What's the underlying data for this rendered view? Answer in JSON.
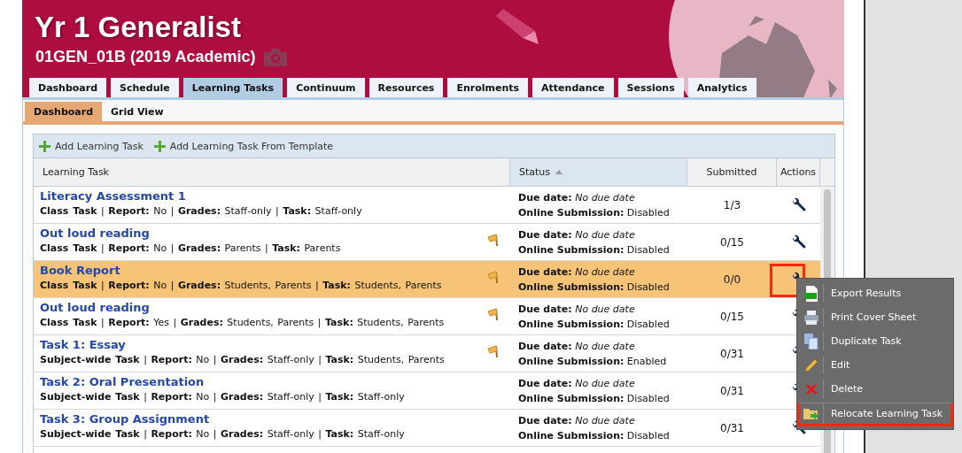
{
  "header": {
    "title": "Yr 1 Generalist",
    "subtitle": "01GEN_01B (2019 Academic)"
  },
  "tabs": [
    {
      "label": "Dashboard",
      "selected": false
    },
    {
      "label": "Schedule",
      "selected": false
    },
    {
      "label": "Learning Tasks",
      "selected": true
    },
    {
      "label": "Continuum",
      "selected": false
    },
    {
      "label": "Resources",
      "selected": false
    },
    {
      "label": "Enrolments",
      "selected": false
    },
    {
      "label": "Attendance",
      "selected": false
    },
    {
      "label": "Sessions",
      "selected": false
    },
    {
      "label": "Analytics",
      "selected": false
    }
  ],
  "subtabs": [
    {
      "label": "Dashboard",
      "selected": true
    },
    {
      "label": "Grid View",
      "selected": false
    }
  ],
  "toolbar": [
    {
      "label": "Add Learning Task"
    },
    {
      "label": "Add Learning Task From Template"
    }
  ],
  "table": {
    "columns": [
      {
        "label": "Learning Task",
        "sorted": false
      },
      {
        "label": "Status",
        "sorted": true
      },
      {
        "label": "Submitted",
        "sorted": false
      },
      {
        "label": "Actions",
        "sorted": false
      }
    ],
    "rows": [
      {
        "name": "Literacy Assessment 1",
        "meta": "**Class Task** | **Report:** No | **Grades:** Staff-only | **Task:** Staff-only",
        "flagged": false,
        "due": "**Due date:** *No due date*",
        "online": "**Online Submission:** Disabled",
        "submitted": "1/3",
        "selected": false
      },
      {
        "name": "Out loud reading",
        "meta": "**Class Task** | **Report:** No | **Grades:** Parents | **Task:** Parents",
        "flagged": true,
        "due": "**Due date:** *No due date*",
        "online": "**Online Submission:** Disabled",
        "submitted": "0/15",
        "selected": false
      },
      {
        "name": "Book Report",
        "meta": "**Class Task** | **Report:** No | **Grades:** Students, Parents | **Task:** Students, Parents",
        "flagged": true,
        "due": "**Due date:** *No due date*",
        "online": "**Online Submission:** Disabled",
        "submitted": "0/0",
        "selected": true
      },
      {
        "name": "Out loud reading",
        "meta": "**Class Task** | **Report:** Yes | **Grades:** Students, Parents | **Task:** Students, Parents",
        "flagged": true,
        "due": "**Due date:** *No due date*",
        "online": "**Online Submission:** Disabled",
        "submitted": "0/15",
        "selected": false
      },
      {
        "name": "Task 1: Essay",
        "meta": "**Subject-wide Task** | **Report:** No | **Grades:** Staff-only | **Task:** Students, Parents",
        "flagged": true,
        "due": "**Due date:** *No due date*",
        "online": "**Online Submission:** Enabled",
        "submitted": "0/31",
        "selected": false
      },
      {
        "name": "Task 2: Oral Presentation",
        "meta": "**Subject-wide Task** | **Report:** No | **Grades:** Staff-only | **Task:** Staff-only",
        "flagged": false,
        "due": "**Due date:** *No due date*",
        "online": "**Online Submission:** Disabled",
        "submitted": "0/31",
        "selected": false
      },
      {
        "name": "Task 3: Group Assignment",
        "meta": "**Subject-wide Task** | **Report:** No | **Grades:** Staff-only | **Task:** Staff-only",
        "flagged": false,
        "due": "**Due date:** *No due date*",
        "online": "**Online Submission:** Disabled",
        "submitted": "0/31",
        "selected": false
      }
    ]
  },
  "menu": {
    "items": [
      {
        "kind": "csv",
        "label": "Export Results",
        "highlighted": false
      },
      {
        "kind": "print",
        "label": "Print Cover Sheet",
        "highlighted": false
      },
      {
        "kind": "duplicate",
        "label": "Duplicate Task",
        "highlighted": false
      },
      {
        "kind": "edit",
        "label": "Edit",
        "highlighted": false
      },
      {
        "kind": "delete",
        "label": "Delete",
        "highlighted": false
      },
      {
        "kind": "relocate",
        "label": "Relocate Learning Task",
        "highlighted": true
      }
    ]
  }
}
